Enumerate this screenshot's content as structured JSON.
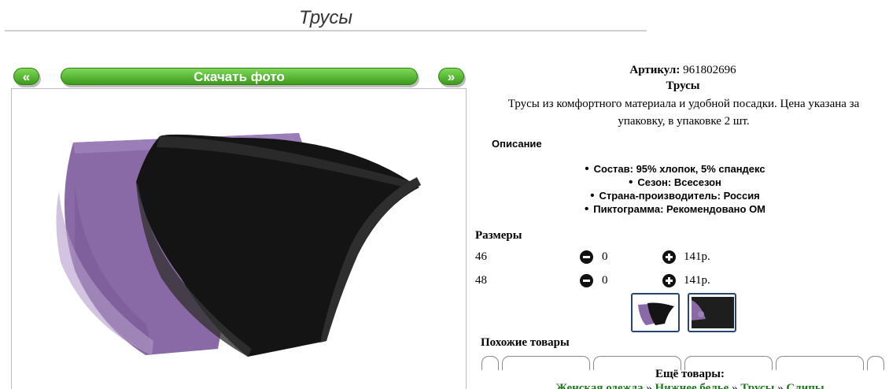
{
  "page": {
    "title": "Трусы"
  },
  "gallery": {
    "prev_label": "«",
    "download_label": "Скачать фото",
    "next_label": "»"
  },
  "product": {
    "article_label": "Артикул:",
    "article_value": "961802696",
    "name": "Трусы",
    "description": "Трусы из комфортного материала и удобной посадки. Цена указана за упаковку, в упаковке 2 шт.",
    "details_heading": "Описание",
    "properties": [
      "Состав: 95% хлопок, 5% спандекс",
      "Сезон: Всесезон",
      "Страна-производитель: Россия",
      "Пиктограмма: Рекомендовано ОМ"
    ]
  },
  "sizes": {
    "heading": "Размеры",
    "rows": [
      {
        "size": "46",
        "qty": "0",
        "price": "141р."
      },
      {
        "size": "48",
        "qty": "0",
        "price": "141р."
      }
    ]
  },
  "similar": {
    "heading": "Похожие товары"
  },
  "more": {
    "heading": "Ещё товары:",
    "links": [
      "Женская одежда",
      "Нижнее белье",
      "Трусы",
      "Слипы"
    ],
    "separator": "»"
  },
  "colors": {
    "accent_green": "#3c9a1c",
    "thumb_border": "#27466e",
    "link_green": "#1a7a1a",
    "panty_purple": "#8a6aa6",
    "panty_black": "#141414"
  }
}
